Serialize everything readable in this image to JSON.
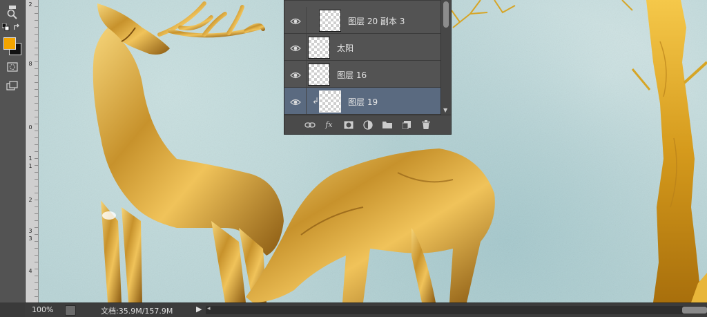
{
  "colors": {
    "foreground": "#f2a400",
    "background": "#111111",
    "active_layer": "#5a6a80"
  },
  "ruler": {
    "labels": [
      "2",
      "8",
      "0",
      "1",
      "1",
      "2",
      "3",
      "3",
      "4"
    ]
  },
  "layers": {
    "rows": [
      {
        "name": "图层 20 副本 3",
        "visible": true,
        "clipped": false,
        "active": false
      },
      {
        "name": "太阳",
        "visible": true,
        "clipped": false,
        "active": false
      },
      {
        "name": "图层 16",
        "visible": true,
        "clipped": false,
        "active": false
      },
      {
        "name": "图层 19",
        "visible": true,
        "clipped": true,
        "active": true
      }
    ],
    "footer_icons": [
      "link-icon",
      "fx-icon",
      "mask-icon",
      "adjustment-icon",
      "folder-icon",
      "new-layer-icon",
      "trash-icon"
    ],
    "fx_label": "fx"
  },
  "status": {
    "zoom": "100%",
    "doc_info": "文档:35.9M/157.9M"
  }
}
